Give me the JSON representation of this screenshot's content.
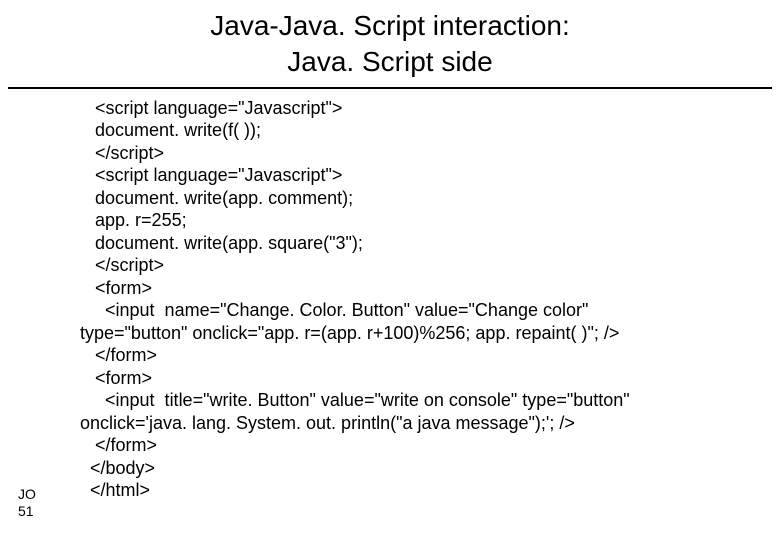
{
  "title_line1": "Java-Java. Script interaction:",
  "title_line2": "Java. Script side",
  "code_lines": [
    "   <script language=\"Javascript\">",
    "   document. write(f( ));",
    "   </script>",
    "   <script language=\"Javascript\">",
    "   document. write(app. comment);",
    "   app. r=255;",
    "   document. write(app. square(\"3\");",
    "   </script>",
    "   <form>",
    "     <input  name=\"Change. Color. Button\" value=\"Change color\" type=\"button\" onclick=\"app. r=(app. r+100)%256; app. repaint( )\"; />",
    "   </form>",
    "   <form>",
    "     <input  title=\"write. Button\" value=\"write on console\" type=\"button\" onclick='java. lang. System. out. println(\"a java message\");'; />",
    "   </form>",
    "  </body>",
    "  </html>"
  ],
  "page_label_line1": "JO",
  "page_label_line2": "51"
}
